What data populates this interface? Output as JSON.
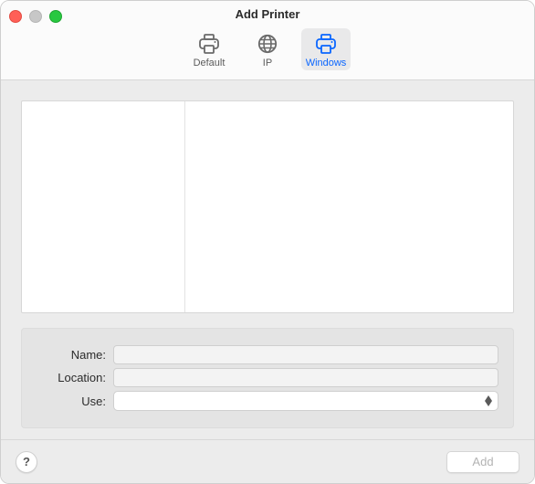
{
  "window": {
    "title": "Add Printer"
  },
  "toolbar": {
    "items": [
      {
        "id": "default",
        "label": "Default",
        "selected": false
      },
      {
        "id": "ip",
        "label": "IP",
        "selected": false
      },
      {
        "id": "windows",
        "label": "Windows",
        "selected": true
      }
    ]
  },
  "panes": {
    "left_items": [],
    "right_items": []
  },
  "form": {
    "name_label": "Name:",
    "name_value": "",
    "location_label": "Location:",
    "location_value": "",
    "use_label": "Use:",
    "use_value": ""
  },
  "footer": {
    "help_label": "?",
    "add_label": "Add",
    "add_enabled": false
  },
  "colors": {
    "accent": "#0a66ff",
    "window_bg": "#ececec"
  }
}
